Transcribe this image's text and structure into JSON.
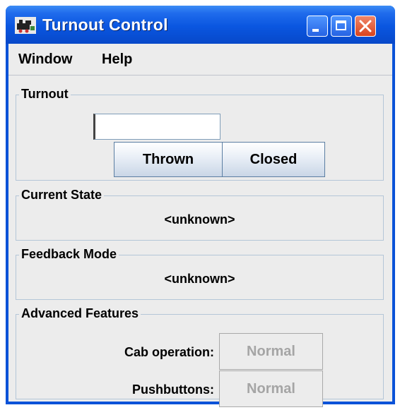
{
  "window": {
    "title": "Turnout Control",
    "icon": "train-app-icon"
  },
  "titlebar_buttons": [
    "minimize-icon",
    "maximize-icon",
    "close-icon"
  ],
  "menu": {
    "items": [
      {
        "label": "Window"
      },
      {
        "label": "Help"
      }
    ]
  },
  "turnout": {
    "title": "Turnout",
    "input_value": "",
    "thrown_label": "Thrown",
    "closed_label": "Closed"
  },
  "current_state": {
    "title": "Current State",
    "value": "<unknown>"
  },
  "feedback_mode": {
    "title": "Feedback Mode",
    "value": "<unknown>"
  },
  "advanced": {
    "title": "Advanced Features",
    "cab_label": "Cab operation:",
    "cab_value": "Normal",
    "push_label": "Pushbuttons:",
    "push_value": "Normal"
  },
  "colors": {
    "titlebar": "#0a56e0",
    "close_button": "#d9441d",
    "background": "#ececec",
    "panel_border": "#b4c6d8",
    "disabled_text": "#a5a5a5"
  }
}
